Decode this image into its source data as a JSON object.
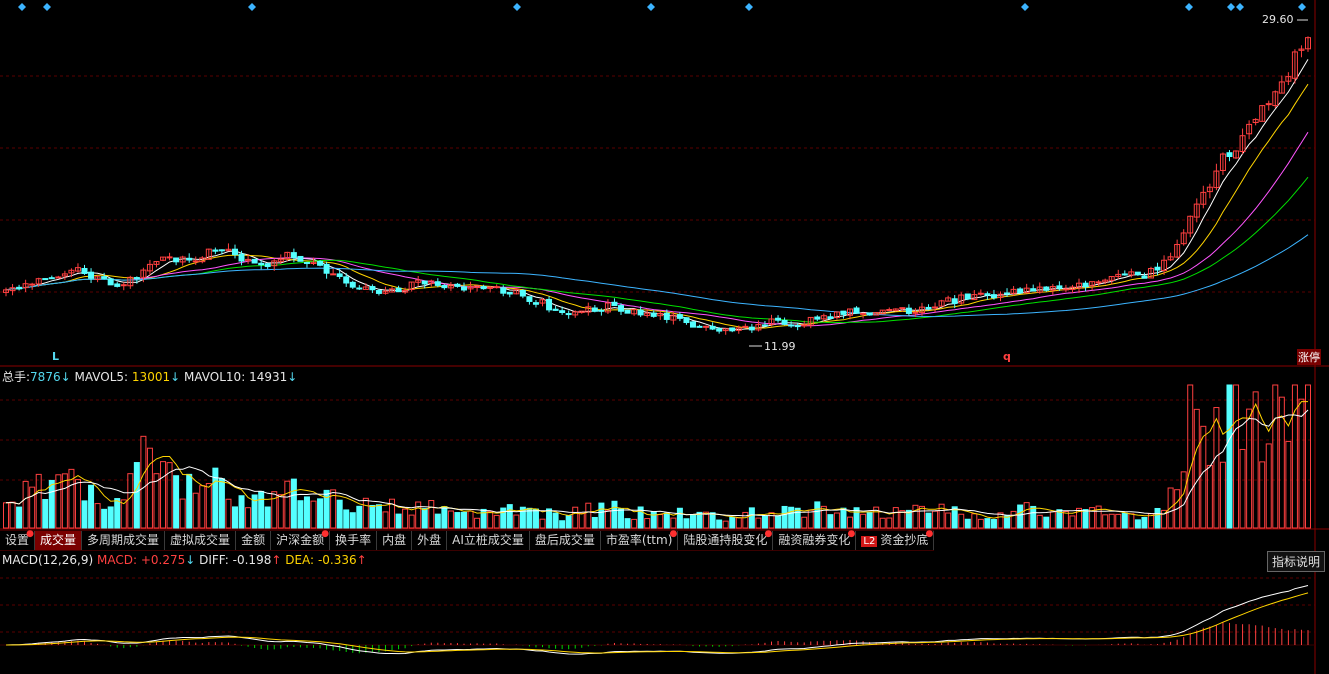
{
  "price_panel": {
    "high_label": "29.60",
    "low_label": "11.99",
    "marker_left": "L",
    "marker_right": "q",
    "badge": "涨停"
  },
  "volume_panel": {
    "zongshou_label": "总手:",
    "zongshou_value": "7876",
    "zongshou_arrow": "↓",
    "mavol5_label": "MAVOL5:",
    "mavol5_value": "13001",
    "mavol5_arrow": "↓",
    "mavol10_label": "MAVOL10:",
    "mavol10_value": "14931",
    "mavol10_arrow": "↓"
  },
  "tabs": [
    {
      "label": "设置",
      "dot": true
    },
    {
      "label": "成交量",
      "active": true
    },
    {
      "label": "多周期成交量"
    },
    {
      "label": "虚拟成交量"
    },
    {
      "label": "金额"
    },
    {
      "label": "沪深金额",
      "dot": true
    },
    {
      "label": "换手率"
    },
    {
      "label": "内盘"
    },
    {
      "label": "外盘"
    },
    {
      "label": "AI立桩成交量"
    },
    {
      "label": "盘后成交量"
    },
    {
      "label": "市盈率(ttm)",
      "dot": true
    },
    {
      "label": "陆股通持股变化",
      "dot": true
    },
    {
      "label": "融资融券变化",
      "dot": true
    },
    {
      "label": "资金抄底",
      "badge": "L2",
      "dot": true
    }
  ],
  "macd_panel": {
    "name": "MACD(12,26,9)",
    "macd_label": "MACD:",
    "macd_value": "+0.275",
    "macd_arrow": "↓",
    "diff_label": "DIFF:",
    "diff_value": "-0.198",
    "diff_arrow": "↑",
    "dea_label": "DEA:",
    "dea_value": "-0.336",
    "dea_arrow": "↑",
    "help_button": "指标说明"
  },
  "colors": {
    "up": "#ff4040",
    "down": "#54ffff",
    "grid": "#5a0000",
    "ma5": "#ffffff",
    "ma10": "#ffd400",
    "ma20": "#ff55ff",
    "ma30": "#00e000",
    "ma60": "#3cb4ff"
  },
  "chart_data": {
    "type": "candlestick",
    "price_axis_visible": false,
    "marked_high": 29.6,
    "marked_low": 11.99,
    "approx_close_path": [
      14.6,
      15.2,
      15.6,
      16.0,
      15.4,
      15.0,
      15.8,
      16.6,
      16.4,
      17.2,
      16.6,
      16.2,
      16.8,
      16.4,
      15.6,
      15.0,
      14.6,
      14.8,
      15.2,
      15.0,
      14.9,
      14.8,
      14.6,
      14.0,
      13.4,
      13.6,
      13.8,
      13.4,
      13.2,
      13.0,
      12.6,
      12.3,
      12.6,
      12.9,
      12.8,
      13.1,
      13.4,
      13.5,
      13.4,
      13.6,
      13.9,
      14.2,
      14.4,
      14.6,
      14.8,
      14.7,
      15.0,
      15.2,
      15.6,
      15.4,
      16.6,
      18.8,
      21.6,
      23.2,
      25.2,
      27.0,
      29.6
    ],
    "volume_shape_relative": [
      0.2,
      0.25,
      0.35,
      0.3,
      0.18,
      0.15,
      0.6,
      0.35,
      0.28,
      0.3,
      0.25,
      0.2,
      0.26,
      0.22,
      0.2,
      0.18,
      0.15,
      0.16,
      0.13,
      0.14,
      0.12,
      0.11,
      0.13,
      0.1,
      0.09,
      0.12,
      0.14,
      0.1,
      0.12,
      0.11,
      0.09,
      0.08,
      0.1,
      0.12,
      0.1,
      0.15,
      0.13,
      0.1,
      0.12,
      0.14,
      0.12,
      0.1,
      0.08,
      0.1,
      0.13,
      0.09,
      0.1,
      0.12,
      0.1,
      0.08,
      0.12,
      0.95,
      0.7,
      1.0,
      0.8,
      0.9,
      0.95
    ]
  }
}
